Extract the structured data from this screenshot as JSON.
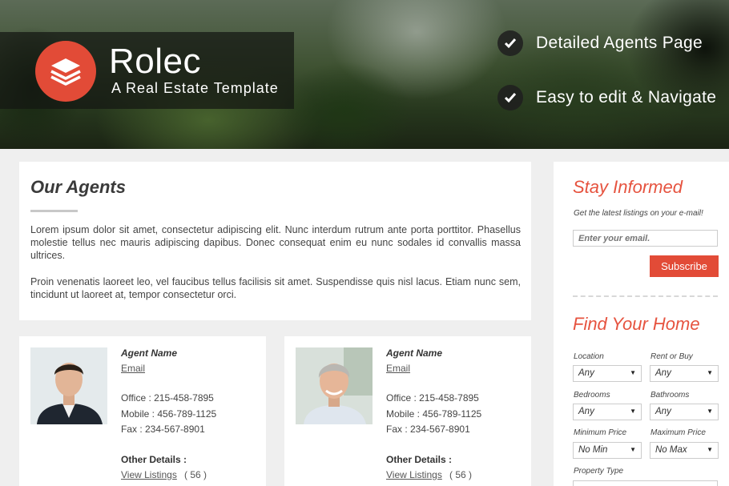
{
  "hero": {
    "brand_title": "Rolec",
    "brand_subtitle": "A Real Estate Template",
    "features": [
      "Detailed Agents Page",
      "Easy to edit & Navigate"
    ]
  },
  "intro": {
    "title": "Our Agents",
    "p1": "Lorem ipsum dolor sit amet, consectetur adipiscing elit. Nunc interdum rutrum ante porta porttitor. Phasellus molestie tellus nec mauris adipiscing dapibus. Donec consequat enim eu nunc sodales id convallis massa ultrices.",
    "p2": "Proin venenatis laoreet leo, vel faucibus tellus facilisis sit amet. Suspendisse quis nisl lacus. Etiam nunc sem, tincidunt ut laoreet at, tempor consectetur orci."
  },
  "agents": [
    {
      "name": "Agent Name",
      "email": "Email",
      "office": "Office : 215-458-7895",
      "mobile": "Mobile : 456-789-1125",
      "fax": "Fax : 234-567-8901",
      "other": "Other Details :",
      "listings_label": "View Listings",
      "listings_count": "( 56 )"
    },
    {
      "name": "Agent Name",
      "email": "Email",
      "office": "Office : 215-458-7895",
      "mobile": "Mobile : 456-789-1125",
      "fax": "Fax : 234-567-8901",
      "other": "Other Details :",
      "listings_label": "View Listings",
      "listings_count": "( 56 )"
    }
  ],
  "sidebar": {
    "stay_title": "Stay Informed",
    "stay_sub": "Get the latest listings on your e-mail!",
    "email_placeholder": "Enter your email.",
    "subscribe": "Subscribe",
    "find_title": "Find Your Home",
    "location_label": "Location",
    "location_value": "Any",
    "rentbuy_label": "Rent or Buy",
    "rentbuy_value": "Any",
    "bedrooms_label": "Bedrooms",
    "bedrooms_value": "Any",
    "bathrooms_label": "Bathrooms",
    "bathrooms_value": "Any",
    "minprice_label": "Minimum Price",
    "minprice_value": "No Min",
    "maxprice_label": "Maximum Price",
    "maxprice_value": "No Max",
    "proptype_label": "Property Type"
  },
  "colors": {
    "accent": "#e24b37",
    "title_accent": "#e6533f"
  }
}
